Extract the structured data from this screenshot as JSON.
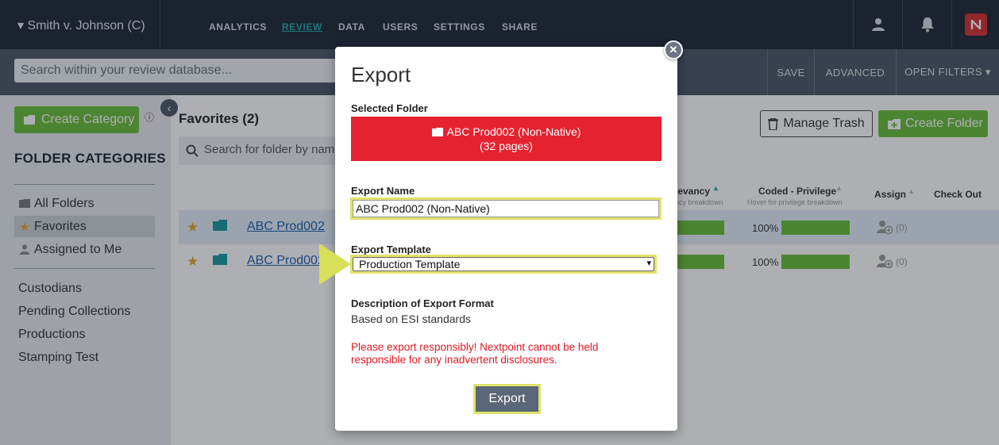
{
  "topbar": {
    "case_title": "▾ Smith v. Johnson (C)",
    "nav": [
      "ANALYTICS",
      "REVIEW",
      "DATA",
      "USERS",
      "SETTINGS",
      "SHARE"
    ],
    "active_nav": "REVIEW"
  },
  "searchbar": {
    "placeholder": "Search within your review database...",
    "save": "SAVE",
    "advanced": "ADVANCED",
    "open_filters": "OPEN FILTERS ▾"
  },
  "sidebar": {
    "create_category": "Create Category",
    "heading": "FOLDER CATEGORIES",
    "items": [
      {
        "label": "All Folders",
        "icon": "folder-icon"
      },
      {
        "label": "Favorites",
        "icon": "star-icon"
      },
      {
        "label": "Assigned to Me",
        "icon": "user-icon"
      }
    ],
    "categories": [
      "Custodians",
      "Pending Collections",
      "Productions",
      "Stamping Test"
    ]
  },
  "main": {
    "favorites_title": "Favorites (2)",
    "folder_search_placeholder": "Search for folder by name",
    "manage_trash": "Manage Trash",
    "create_folder": "Create Folder",
    "columns": {
      "relevancy": "levancy",
      "relevancy_sub": "ncy breakdown",
      "coded_privilege": "Coded - Privilege",
      "coded_privilege_sub": "Hover for privilege breakdown",
      "assign": "Assign",
      "check_out": "Check Out"
    },
    "rows": [
      {
        "name": "ABC Prod002",
        "privilege_pct": "100%",
        "relevancy_progress": 1.0,
        "privilege_progress": 1.0,
        "assign_count": "(0)"
      },
      {
        "name": "ABC Prod002",
        "privilege_pct": "100%",
        "relevancy_progress": 1.0,
        "privilege_progress": 1.0,
        "assign_count": "(0)"
      }
    ]
  },
  "modal": {
    "title": "Export",
    "selected_folder_label": "Selected Folder",
    "selected_folder_name": "ABC Prod002 (Non-Native)",
    "selected_folder_pages": "(32 pages)",
    "export_name_label": "Export Name",
    "export_name_value": "ABC Prod002 (Non-Native)",
    "export_template_label": "Export Template",
    "export_template_value": "Production Template",
    "description_label": "Description of Export Format",
    "description_value": "Based on ESI standards",
    "warning": "Please export responsibly! Nextpoint cannot be held responsible for any inadvertent disclosures.",
    "export_button": "Export"
  },
  "colors": {
    "nav_bg": "#1f2937",
    "accent_green": "#6abf3a",
    "folder_red": "#e52330",
    "highlight_yellow": "#dfe36a",
    "warning_red": "#e21a24"
  }
}
